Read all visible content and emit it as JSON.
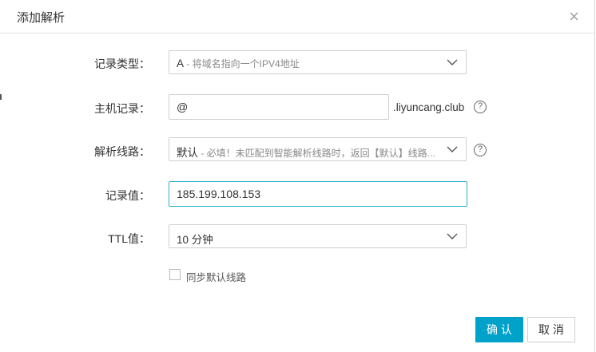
{
  "dialog": {
    "title": "添加解析",
    "close_icon": "close-icon"
  },
  "form": {
    "record_type": {
      "label": "记录类型：",
      "value": "A",
      "hint": " - 将域名指向一个IPV4地址"
    },
    "host": {
      "label": "主机记录：",
      "value": "@",
      "suffix": ".liyuncang.club"
    },
    "line": {
      "label": "解析线路：",
      "value": "默认",
      "hint": " - 必填！未匹配到智能解析线路时，返回【默认】线路..."
    },
    "record_value": {
      "label": "记录值：",
      "value": "185.199.108.153"
    },
    "ttl": {
      "label": "TTL值：",
      "value": "10 分钟"
    },
    "sync_default": {
      "label": "同步默认线路",
      "checked": false
    }
  },
  "buttons": {
    "ok": "确 认",
    "cancel": "取 消"
  },
  "colors": {
    "primary": "#00a2ca",
    "focus_border": "#2fb0c8"
  }
}
